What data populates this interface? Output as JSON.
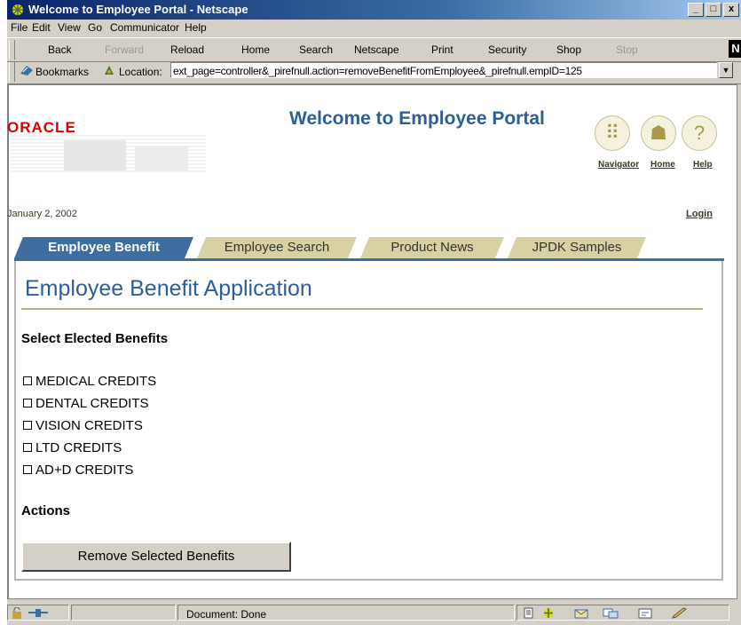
{
  "window": {
    "title": "Welcome to Employee Portal - Netscape",
    "controls": [
      "_",
      "□",
      "x"
    ]
  },
  "menu": [
    "File",
    "Edit",
    "View",
    "Go",
    "Communicator",
    "Help"
  ],
  "toolbar": {
    "back": "Back",
    "forward": "Forward",
    "reload": "Reload",
    "home": "Home",
    "search": "Search",
    "netscape": "Netscape",
    "print": "Print",
    "security": "Security",
    "shop": "Shop",
    "stop": "Stop"
  },
  "location": {
    "bookmarks": "Bookmarks",
    "label": "Location:",
    "url": "ext_page=controller&_pirefnull.action=removeBenefitFromEmployee&_pirefnull.empID=125"
  },
  "portal": {
    "brand": "ORACLE",
    "title": "Welcome to Employee Portal",
    "links": [
      "Navigator",
      "Home",
      "Help"
    ],
    "date": "January 2, 2002",
    "login": "Login",
    "tabs": [
      "Employee Benefit",
      "Employee Search",
      "Product News",
      "JPDK Samples"
    ],
    "active_tab": 0
  },
  "app": {
    "title": "Employee Benefit Application",
    "select_heading": "Select Elected Benefits",
    "benefits": [
      "MEDICAL CREDITS",
      "DENTAL CREDITS",
      "VISION CREDITS",
      "LTD CREDITS",
      "AD+D CREDITS"
    ],
    "actions_heading": "Actions",
    "remove_button": "Remove Selected Benefits"
  },
  "status": {
    "text": "Document: Done"
  },
  "colors": {
    "title_blue": "#2b5f99",
    "tab_active": "#3e6ea0",
    "tab_inactive": "#d8d2a2",
    "oracle_red": "#dd0000"
  }
}
